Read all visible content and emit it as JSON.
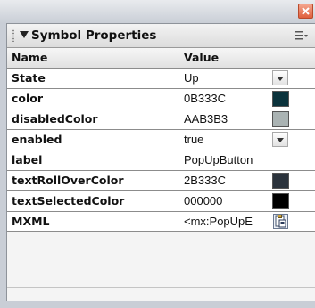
{
  "panel": {
    "title": "Symbol Properties"
  },
  "table": {
    "columns": [
      "Name",
      "Value"
    ],
    "rows": [
      {
        "name": "State",
        "value": "Up",
        "control": "dropdown"
      },
      {
        "name": "color",
        "value": "0B333C",
        "control": "color-swatch",
        "swatch_color": "#0b333c"
      },
      {
        "name": "disabledColor",
        "value": "AAB3B3",
        "control": "color-swatch",
        "swatch_color": "#aab3b3"
      },
      {
        "name": "enabled",
        "value": "true",
        "control": "dropdown"
      },
      {
        "name": "label",
        "value": "PopUpButton",
        "control": "none"
      },
      {
        "name": "textRollOverColor",
        "value": "2B333C",
        "control": "color-swatch",
        "swatch_color": "#2b333c"
      },
      {
        "name": "textSelectedColor",
        "value": "000000",
        "control": "color-swatch",
        "swatch_color": "#000000"
      },
      {
        "name": "MXML",
        "value": "<mx:PopUpE",
        "control": "clipboard-icon"
      }
    ]
  },
  "colors": {
    "panel_bg": "#f4f4f4",
    "grid_line": "#8c8c8c",
    "close_button": "#e0603d"
  }
}
